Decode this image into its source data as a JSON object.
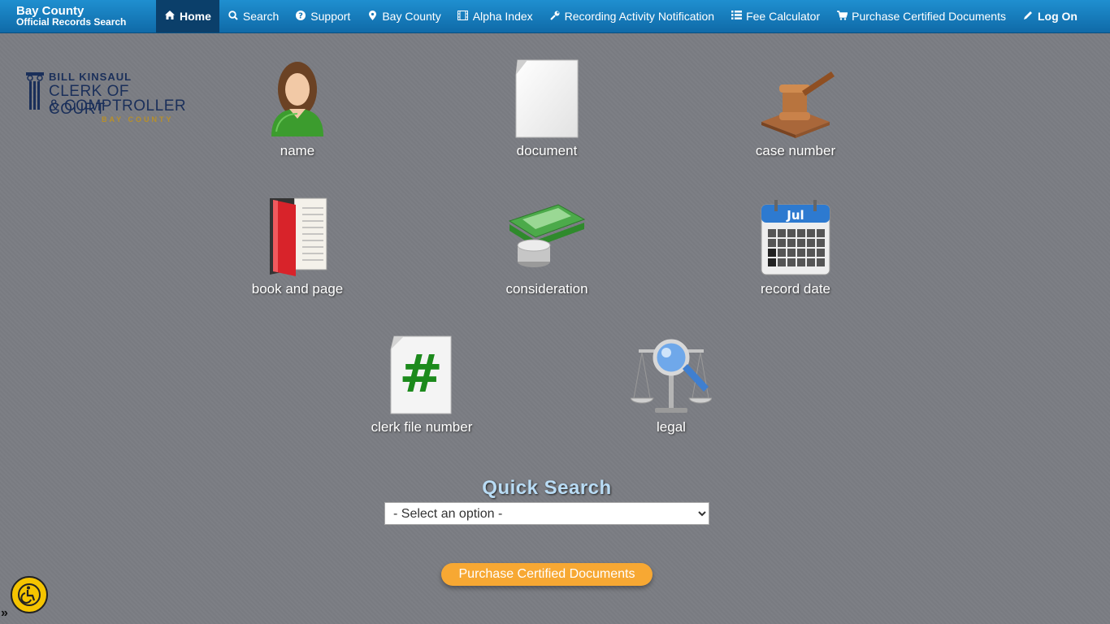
{
  "brand": {
    "title": "Bay County",
    "subtitle": "Official Records Search"
  },
  "nav": {
    "items": [
      {
        "label": "Home",
        "icon": "home-icon",
        "active": true
      },
      {
        "label": "Search",
        "icon": "search-icon"
      },
      {
        "label": "Support",
        "icon": "question-circle-icon"
      },
      {
        "label": "Bay County",
        "icon": "map-marker-icon"
      },
      {
        "label": "Alpha Index",
        "icon": "film-icon"
      },
      {
        "label": "Recording Activity Notification",
        "icon": "wrench-icon"
      },
      {
        "label": "Fee Calculator",
        "icon": "list-icon"
      },
      {
        "label": "Purchase Certified Documents",
        "icon": "shopping-cart-icon"
      }
    ],
    "login": {
      "label": "Log On",
      "icon": "pencil-icon"
    }
  },
  "logo": {
    "line1": "BILL KINSAUL",
    "line2": "CLERK OF COURT",
    "line3": "& COMPTROLLER",
    "line4": "BAY COUNTY"
  },
  "tiles": [
    {
      "label": "name",
      "icon": "person-icon"
    },
    {
      "label": "document",
      "icon": "document-icon"
    },
    {
      "label": "case number",
      "icon": "gavel-icon"
    },
    {
      "label": "book and page",
      "icon": "book-icon"
    },
    {
      "label": "consideration",
      "icon": "money-icon"
    },
    {
      "label": "record date",
      "icon": "calendar-icon"
    },
    {
      "label": "clerk file number",
      "icon": "hash-icon"
    },
    {
      "label": "legal",
      "icon": "scales-magnifier-icon"
    }
  ],
  "calendar_month": "Jul",
  "quick_search": {
    "title": "Quick Search",
    "selected": "- Select an option -"
  },
  "purchase_button": "Purchase Certified Documents",
  "toggle": "»",
  "colors": {
    "nav_top": "#1f8fd0",
    "nav_bottom": "#0f6aa8",
    "accent_orange": "#f7a833",
    "background": "#7b7d83"
  }
}
